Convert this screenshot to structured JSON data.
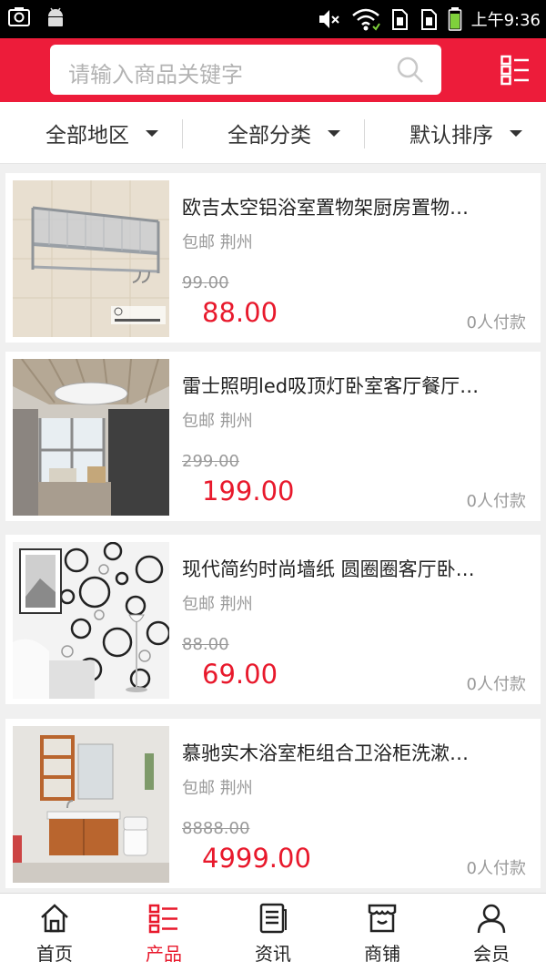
{
  "status_bar": {
    "time": "上午9:36"
  },
  "search": {
    "placeholder": "请输入商品关键字"
  },
  "filters": [
    {
      "label": "全部地区"
    },
    {
      "label": "全部分类"
    },
    {
      "label": "默认排序"
    }
  ],
  "products": [
    {
      "title": "欧吉太空铝浴室置物架厨房置物…",
      "shipping": "包邮",
      "city": "荆州",
      "old_price": "99.00",
      "price": "88.00",
      "sold": "0人付款"
    },
    {
      "title": "雷士照明led吸顶灯卧室客厅餐厅…",
      "shipping": "包邮",
      "city": "荆州",
      "old_price": "299.00",
      "price": "199.00",
      "sold": "0人付款"
    },
    {
      "title": "现代简约时尚墙纸 圆圈圈客厅卧…",
      "shipping": "包邮",
      "city": "荆州",
      "old_price": "88.00",
      "price": "69.00",
      "sold": "0人付款"
    },
    {
      "title": "慕驰实木浴室柜组合卫浴柜洗漱…",
      "shipping": "包邮",
      "city": "荆州",
      "old_price": "8888.00",
      "price": "4999.00",
      "sold": "0人付款"
    }
  ],
  "bottom_nav": [
    {
      "label": "首页",
      "icon": "home-icon"
    },
    {
      "label": "产品",
      "icon": "product-list-icon",
      "active": true
    },
    {
      "label": "资讯",
      "icon": "news-icon"
    },
    {
      "label": "商铺",
      "icon": "store-icon"
    },
    {
      "label": "会员",
      "icon": "member-icon"
    }
  ],
  "colors": {
    "brand": "#ed1c3a",
    "price": "#e8192c",
    "muted": "#999999"
  }
}
